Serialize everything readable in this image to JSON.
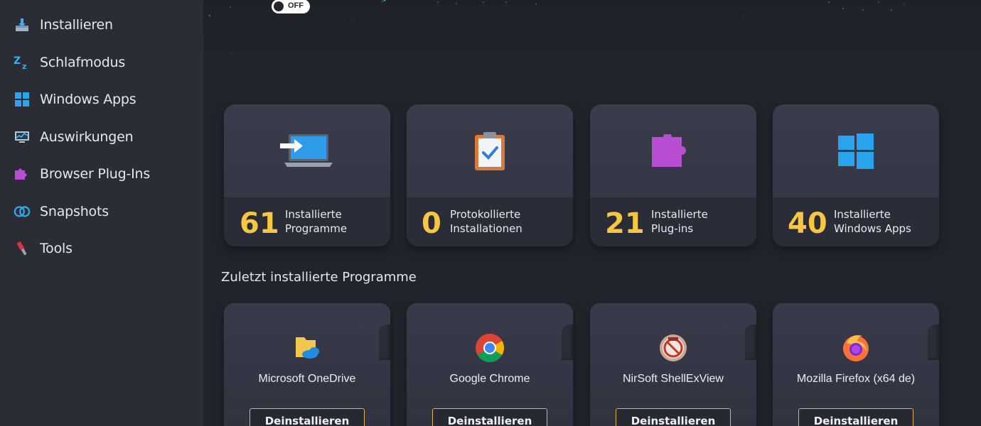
{
  "sidebar": {
    "items": [
      {
        "label": "Installieren",
        "icon": "install-icon"
      },
      {
        "label": "Schlafmodus",
        "icon": "sleep-icon"
      },
      {
        "label": "Windows Apps",
        "icon": "windows-icon"
      },
      {
        "label": "Auswirkungen",
        "icon": "monitor-chart-icon"
      },
      {
        "label": "Browser Plug-Ins",
        "icon": "puzzle-icon"
      },
      {
        "label": "Snapshots",
        "icon": "rings-icon"
      },
      {
        "label": "Tools",
        "icon": "tools-icon"
      }
    ]
  },
  "header": {
    "toggle_label": "OFF"
  },
  "stats": [
    {
      "number": "61",
      "label_line1": "Installierte",
      "label_line2": "Programme",
      "icon": "laptop-install-icon"
    },
    {
      "number": "0",
      "label_line1": "Protokollierte",
      "label_line2": "Installationen",
      "icon": "clipboard-check-icon"
    },
    {
      "number": "21",
      "label_line1": "Installierte",
      "label_line2": "Plug-ins",
      "icon": "puzzle-icon"
    },
    {
      "number": "40",
      "label_line1": "Installierte",
      "label_line2": "Windows Apps",
      "icon": "windows-icon"
    }
  ],
  "recent": {
    "title": "Zuletzt installierte Programme",
    "programs": [
      {
        "name": "Microsoft OneDrive",
        "icon": "onedrive-icon",
        "button": "Deinstallieren"
      },
      {
        "name": "Google Chrome",
        "icon": "chrome-icon",
        "button": "Deinstallieren"
      },
      {
        "name": "NirSoft ShellExView",
        "icon": "shellexview-icon",
        "button": "Deinstallieren"
      },
      {
        "name": "Mozilla Firefox (x64 de)",
        "icon": "firefox-icon",
        "button": "Deinstallieren"
      }
    ]
  },
  "colors": {
    "accent": "#f8c640",
    "button_border": "#e4b345",
    "sidebar_bg": "#2a2c36",
    "main_bg": "#22242c"
  }
}
